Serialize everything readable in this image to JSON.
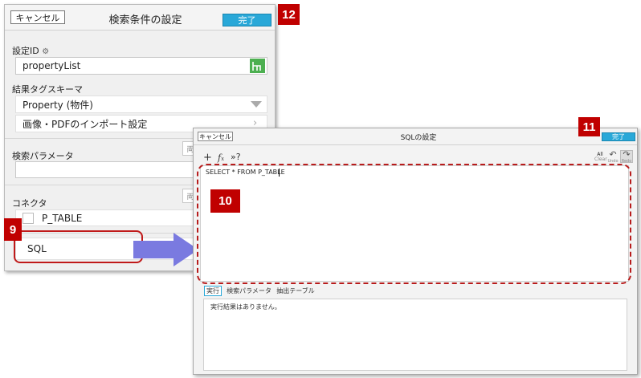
{
  "back_dialog": {
    "cancel_label": "キャンセル",
    "title": "検索条件の設定",
    "done_label": "完了",
    "setting_id_label": "設定ID",
    "setting_id_value": "propertyList",
    "result_tag_schema_label": "結果タグスキーマ",
    "schema_value": "Property (物件)",
    "import_setting_label": "画像・PDFのインポート設定",
    "search_params_label": "検索パラメータ",
    "params_button_partial": "両",
    "connector_label": "コネクタ",
    "connector_button_partial": "両",
    "connector_value": "P_TABLE",
    "sql_value": "SQL"
  },
  "front_dialog": {
    "cancel_label": "キャンセル",
    "title": "SQLの設定",
    "done_label": "完了",
    "toolbar": {
      "all_label": "All",
      "clear_label": "Clear",
      "undo_label": "Undo",
      "redo_label": "Redo"
    },
    "sql_text": "SELECT * FROM P_TABLE",
    "tabs": [
      "実行",
      "検索パラメータ",
      "抽出テーブル"
    ],
    "result_text": "実行結果はありません。"
  },
  "badges": {
    "b9": "9",
    "b10": "10",
    "b11": "11",
    "b12": "12"
  },
  "colors": {
    "badge": "#c00000",
    "done_button": "#29a8d8",
    "arrow": "#7a7ae0"
  }
}
